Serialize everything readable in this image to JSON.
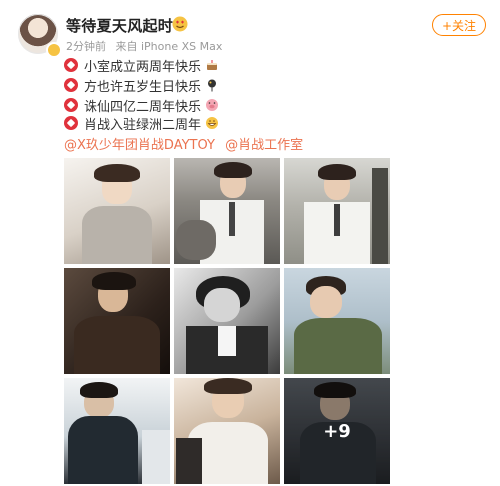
{
  "post": {
    "username": "等待夏天风起时",
    "meta": {
      "time": "2分钟前",
      "source": "来自 iPhone XS Max"
    },
    "follow_label": "+关注",
    "lines": [
      "小室成立两周年快乐",
      "方也许五岁生日快乐",
      "诛仙四亿二周年快乐",
      "肖战入驻绿洲二周年"
    ],
    "mentions": [
      "@X玖少年团肖战DAYTOY",
      "@肖战工作室"
    ],
    "more_count": "+9"
  },
  "colors": {
    "accent_orange": "#ff8200",
    "mention_orange": "#eb7350",
    "bullet_red": "#e0323c"
  },
  "icons": {
    "bullet": "red-badge-icon",
    "line_emojis": [
      "cake-icon",
      "balloon-icon",
      "pig-face-icon",
      "grin-face-icon"
    ]
  }
}
